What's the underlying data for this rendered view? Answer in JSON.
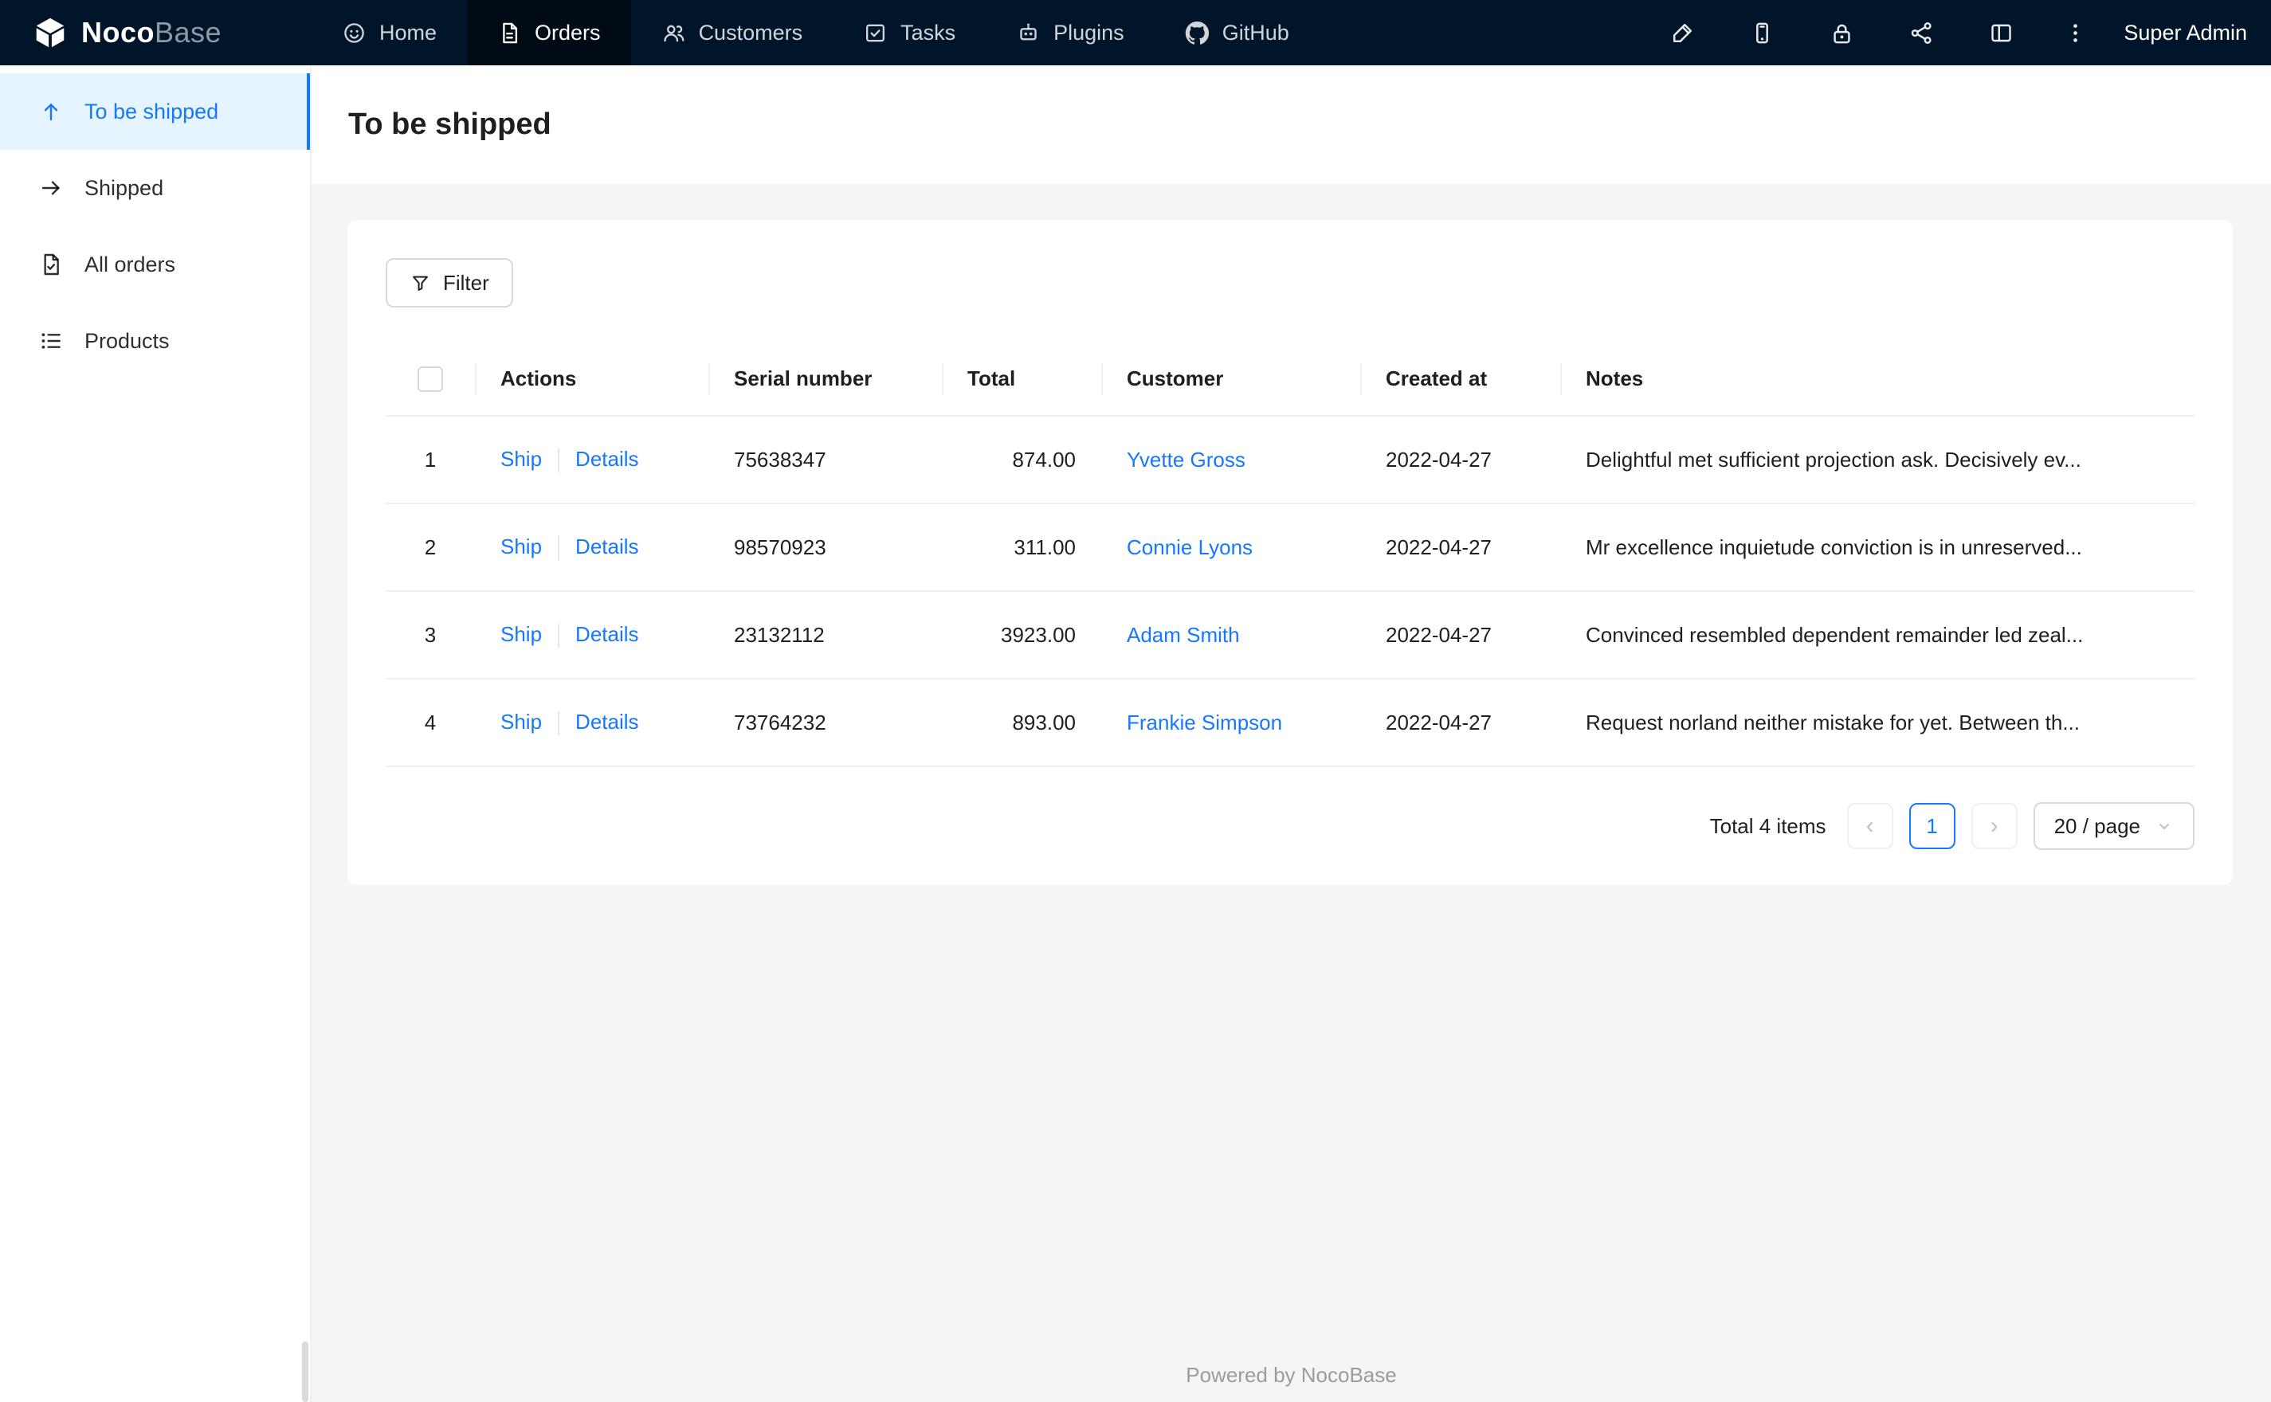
{
  "navbar": {
    "brand": {
      "bold": "Noco",
      "light": "Base"
    },
    "items": [
      {
        "label": "Home",
        "active": false
      },
      {
        "label": "Orders",
        "active": true
      },
      {
        "label": "Customers",
        "active": false
      },
      {
        "label": "Tasks",
        "active": false
      },
      {
        "label": "Plugins",
        "active": false
      },
      {
        "label": "GitHub",
        "active": false
      }
    ],
    "user": "Super Admin"
  },
  "sidebar": {
    "items": [
      {
        "label": "To be shipped",
        "active": true
      },
      {
        "label": "Shipped",
        "active": false
      },
      {
        "label": "All orders",
        "active": false
      },
      {
        "label": "Products",
        "active": false
      }
    ]
  },
  "page": {
    "title": "To be shipped"
  },
  "toolbar": {
    "filter": "Filter"
  },
  "table": {
    "columns": [
      "Actions",
      "Serial number",
      "Total",
      "Customer",
      "Created at",
      "Notes"
    ],
    "actions": {
      "ship": "Ship",
      "details": "Details"
    },
    "rows": [
      {
        "index": "1",
        "serial": "75638347",
        "total": "874.00",
        "customer": "Yvette Gross",
        "created": "2022-04-27",
        "notes": "Delightful met sufficient projection ask. Decisively ev..."
      },
      {
        "index": "2",
        "serial": "98570923",
        "total": "311.00",
        "customer": "Connie Lyons",
        "created": "2022-04-27",
        "notes": "Mr excellence inquietude conviction is in unreserved..."
      },
      {
        "index": "3",
        "serial": "23132112",
        "total": "3923.00",
        "customer": "Adam Smith",
        "created": "2022-04-27",
        "notes": "Convinced resembled dependent remainder led zeal..."
      },
      {
        "index": "4",
        "serial": "73764232",
        "total": "893.00",
        "customer": "Frankie Simpson",
        "created": "2022-04-27",
        "notes": "Request norland neither mistake for yet. Between th..."
      }
    ]
  },
  "pagination": {
    "total": "Total 4 items",
    "prev": "‹",
    "page": "1",
    "next": "›",
    "page_size": "20 / page"
  },
  "footer": {
    "text": "Powered by NocoBase"
  },
  "colors": {
    "accent": "#1677ff",
    "navbar_bg": "#001529",
    "sidebar_selected_bg": "#e6f4ff",
    "content_bg": "#f5f5f5"
  }
}
